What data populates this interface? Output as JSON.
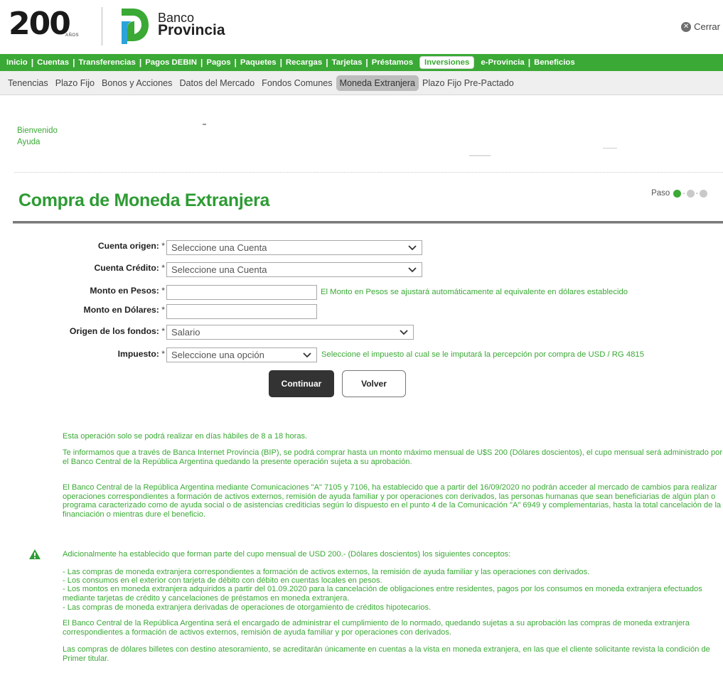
{
  "header": {
    "logo_anniversary": "200",
    "logo_anios": "AÑOS",
    "brand_line1": "Banco",
    "brand_line2": "Provincia",
    "close_label": "Cerrar"
  },
  "main_nav": {
    "items": [
      "Inicio",
      "Cuentas",
      "Transferencias",
      "Pagos DEBIN",
      "Pagos",
      "Paquetes",
      "Recargas",
      "Tarjetas",
      "Préstamos",
      "Inversiones",
      "e-Provincia",
      "Beneficios"
    ],
    "active": "Inversiones",
    "separator": "|"
  },
  "sub_nav": {
    "items": [
      "Tenencias",
      "Plazo Fijo",
      "Bonos y Acciones",
      "Datos del Mercado",
      "Fondos Comunes",
      "Moneda Extranjera",
      "Plazo Fijo Pre-Pactado"
    ],
    "active": "Moneda Extranjera"
  },
  "welcome": {
    "greeting": "Bienvenido",
    "help": "Ayuda"
  },
  "page": {
    "title": "Compra de Moneda Extranjera",
    "step_label": "Paso",
    "step_current": 1,
    "step_total": 3
  },
  "form": {
    "cuenta_origen": {
      "label": "Cuenta origen:",
      "value": "Seleccione una Cuenta"
    },
    "cuenta_credito": {
      "label": "Cuenta Crédito:",
      "value": "Seleccione una Cuenta"
    },
    "monto_pesos": {
      "label": "Monto en Pesos:",
      "value": "",
      "hint": "El Monto en Pesos se ajustará automáticamente al equivalente en dólares establecido"
    },
    "monto_dolares": {
      "label": "Monto en Dólares:",
      "value": ""
    },
    "origen_fondos": {
      "label": "Origen de los fondos:",
      "value": "Salario"
    },
    "impuesto": {
      "label": "Impuesto:",
      "value": "Seleccione una opción",
      "hint": "Seleccione el impuesto al cual se le imputará la percepción por compra de USD / RG 4815"
    },
    "required_mark": "*",
    "continue_label": "Continuar",
    "back_label": "Volver"
  },
  "info": {
    "p1": "Esta operación solo se podrá realizar en días hábiles de 8 a 18 horas.",
    "p2": "Te informamos que a través de Banca Internet Provincia (BIP), se podrá comprar hasta un monto máximo mensual de U$S 200 (Dólares doscientos), el cupo mensual será administrado por el Banco Central de la República Argentina quedando la presente operación sujeta a su aprobación.",
    "p3": "El Banco Central de la República Argentina mediante Comunicaciones \"A\" 7105 y 7106, ha establecido que a partir del 16/09/2020 no podrán acceder al mercado de cambios para realizar operaciones correspondientes a formación de activos externos, remisión de ayuda familiar y por operaciones con derivados, las personas humanas que sean beneficiarias de algún plan o programa caracterizado como de ayuda social o de asistencias crediticias según lo dispuesto en el punto 4 de la Comunicación \"A\" 6949 y complementarias, hasta la total cancelación de la financiación o mientras dure el beneficio.",
    "p4": "Adicionalmente ha establecido que forman parte del cupo mensual de USD 200.- (Dólares doscientos) los siguientes conceptos:",
    "bullets": [
      "- Las compras de moneda extranjera correspondientes a formación de activos externos, la remisión de ayuda familiar y las operaciones con derivados.",
      "- Los consumos en el exterior con tarjeta de débito con débito en cuentas locales en pesos.",
      "- Los montos en moneda extranjera adquiridos a partir del 01.09.2020 para la cancelación de obligaciones entre residentes, pagos por los consumos en moneda extranjera efectuados mediante tarjetas de crédito y cancelaciones de préstamos en moneda extranjera.",
      "- Las compras de moneda extranjera derivadas de operaciones de otorgamiento de créditos hipotecarios."
    ],
    "p5": "El Banco Central de la República Argentina será el encargado de administrar el cumplimiento de lo normado, quedando sujetas a su aprobación las compras de moneda extranjera correspondientes a formación de activos externos, remisión de ayuda familiar y por operaciones con derivados.",
    "p6": "Las compras de dólares billetes con destino atesoramiento, se acreditarán únicamente en cuentas a la vista en moneda extranjera, en las que el cliente solicitante revista la condición de Primer titular."
  },
  "colors": {
    "brand_green": "#3aa935",
    "title_green": "#2e9b34",
    "dark_button": "#333333"
  }
}
